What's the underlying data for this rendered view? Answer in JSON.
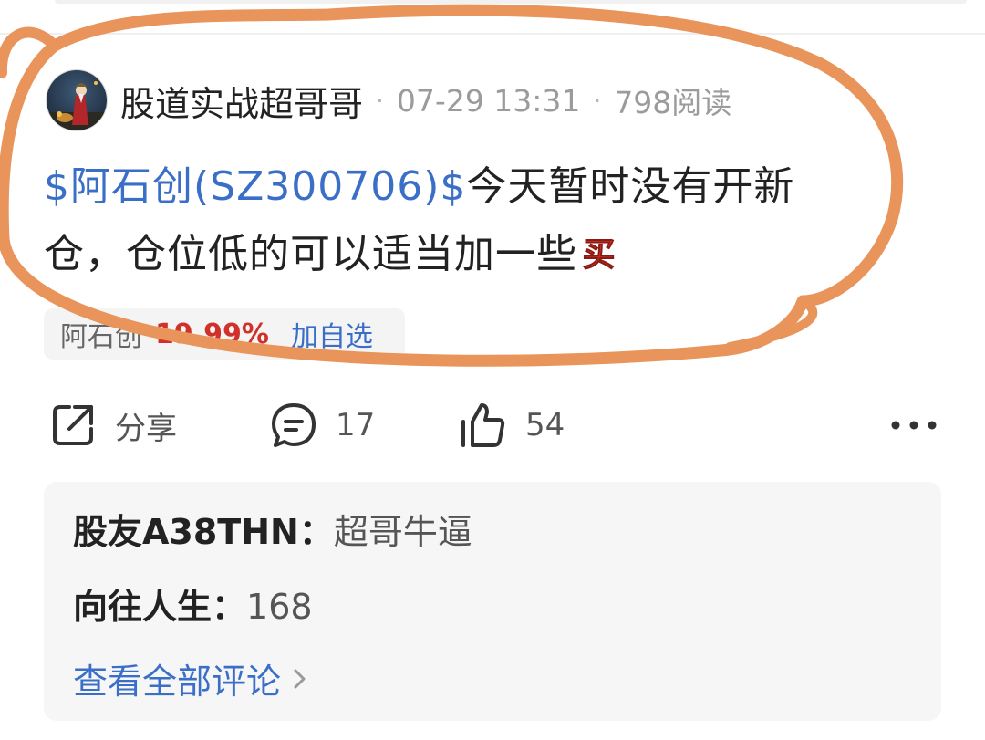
{
  "post": {
    "author": "股道实战超哥哥",
    "date": "07-29 13:31",
    "reads": "798阅读",
    "stock_link": "$阿石创(SZ300706)$",
    "text_part1": "今天暂时没有开新",
    "text_part2": "仓，仓位低的可以适当加一些",
    "emoji_name": "buy-emoji",
    "emoji_char": "买"
  },
  "stock_chip": {
    "name": "阿石创",
    "change": "19.99%",
    "add_label": "加自选"
  },
  "actions": {
    "share_label": "分享",
    "comment_count": "17",
    "like_count": "54",
    "more_icon": "more-dots-icon"
  },
  "comments": [
    {
      "author": "股友A38THN",
      "sep": "：",
      "text": "超哥牛逼"
    },
    {
      "author": "向往人生",
      "sep": "：",
      "text": "168"
    }
  ],
  "view_all_label": "查看全部评论",
  "colors": {
    "link": "#3b6fc7",
    "up": "#d0322b",
    "annotation": "#e8945a"
  }
}
